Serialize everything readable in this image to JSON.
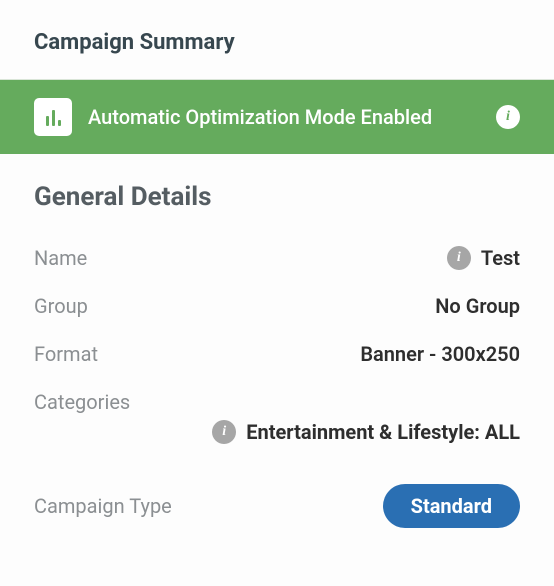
{
  "page_title": "Campaign Summary",
  "banner": {
    "message": "Automatic Optimization Mode Enabled",
    "info_glyph": "i"
  },
  "general": {
    "section_title": "General Details",
    "name_label": "Name",
    "name_value": "Test",
    "name_info_glyph": "i",
    "group_label": "Group",
    "group_value": "No Group",
    "format_label": "Format",
    "format_value": "Banner - 300x250",
    "categories_label": "Categories",
    "categories_info_glyph": "i",
    "categories_value": "Entertainment & Lifestyle: ALL",
    "campaign_type_label": "Campaign Type",
    "campaign_type_value": "Standard"
  }
}
